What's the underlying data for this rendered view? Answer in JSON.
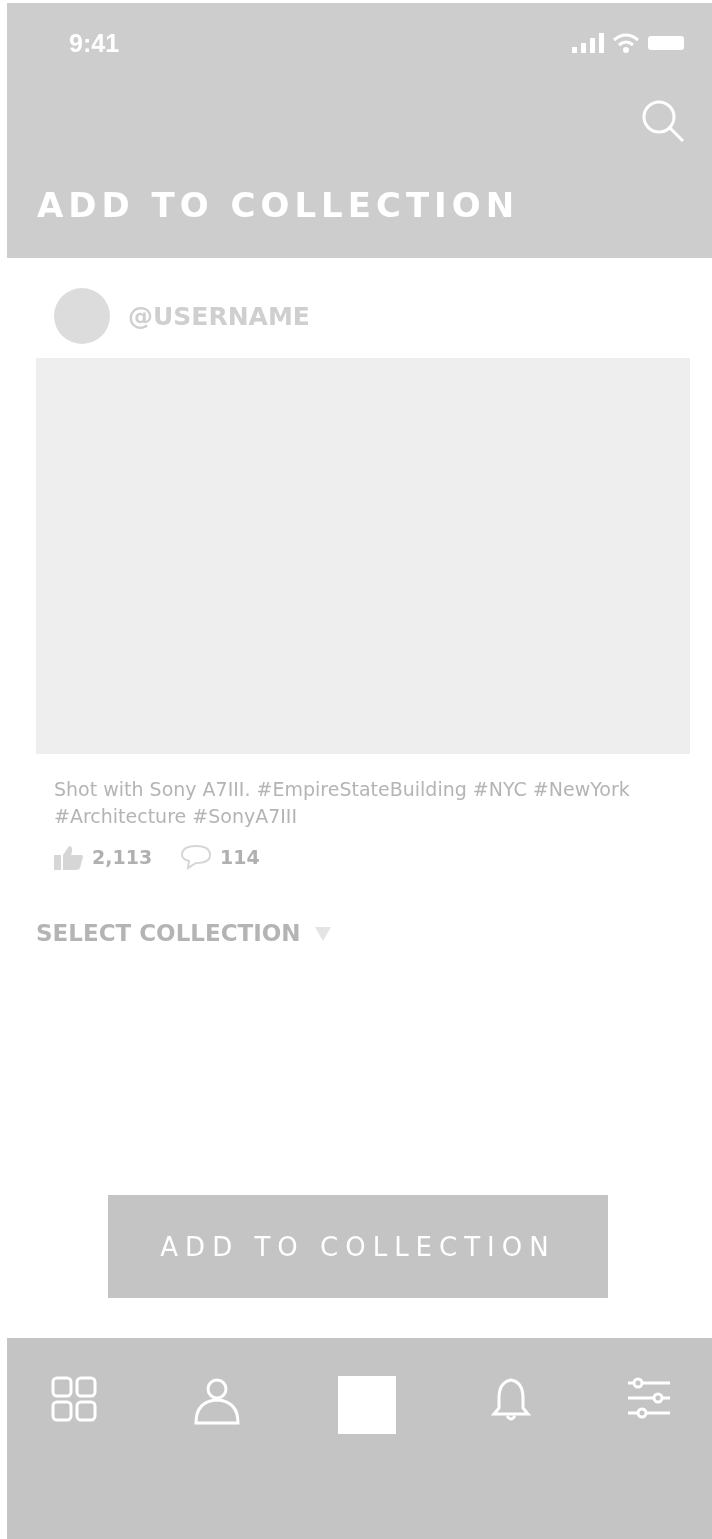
{
  "status_bar": {
    "time": "9:41"
  },
  "header": {
    "title": "ADD TO COLLECTION"
  },
  "post": {
    "username": "@USERNAME",
    "caption": "Shot with Sony A7III. #EmpireStateBuilding #NYC #NewYork #Architecture #SonyA7III",
    "likes": "2,113",
    "comments": "114"
  },
  "collection_select": {
    "label": "SELECT COLLECTION"
  },
  "primary_button": {
    "label": "ADD TO COLLECTION"
  },
  "bottom_nav": {
    "items": [
      {
        "kind": "grid"
      },
      {
        "kind": "profile"
      },
      {
        "kind": "square"
      },
      {
        "kind": "bell"
      },
      {
        "kind": "sliders"
      }
    ]
  }
}
